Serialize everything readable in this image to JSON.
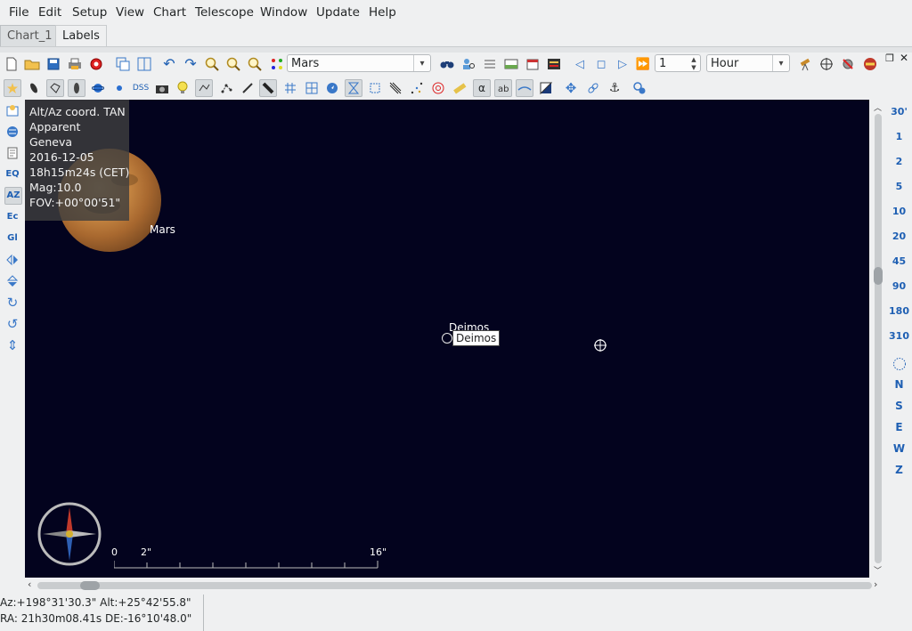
{
  "menu": {
    "file": "File",
    "edit": "Edit",
    "setup": "Setup",
    "view": "View",
    "chart": "Chart",
    "telescope": "Telescope",
    "window": "Window",
    "update": "Update",
    "help": "Help"
  },
  "tabs": {
    "chart": "Chart_1",
    "labels": "Labels"
  },
  "toolbar": {
    "object_search": "Mars",
    "step_value": "1",
    "step_unit": "Hour"
  },
  "toolbar2": {
    "dss": "DSS"
  },
  "lefttb": {
    "eq": "EQ",
    "az": "AZ",
    "ec": "Ec",
    "gl": "Gl"
  },
  "info_panel": {
    "line1": "Alt/Az coord. TAN",
    "line2": "Apparent",
    "line3": "Geneva",
    "line4": "2016-12-05",
    "line5": "18h15m24s (CET)",
    "line6": "Mag:10.0",
    "line7": "FOV:+00°00'51\""
  },
  "chart": {
    "mars_label": "Mars",
    "deimos_label": "Deimos",
    "deimos_tooltip": "Deimos",
    "scale": {
      "zero": "0",
      "small": "2\"",
      "large": "16\""
    }
  },
  "fov_buttons": [
    "30'",
    "1",
    "2",
    "5",
    "10",
    "20",
    "45",
    "90",
    "180",
    "310"
  ],
  "pole_buttons": {
    "n": "N",
    "s": "S",
    "e": "E",
    "w": "W",
    "z": "Z"
  },
  "status": {
    "altaz": "Az:+198°31'30.3\" Alt:+25°42'55.8\"",
    "radec": "RA: 21h30m08.41s DE:-16°10'48.0\""
  },
  "colors": {
    "sky": "#03031e",
    "accent": "#1e5fb3"
  }
}
